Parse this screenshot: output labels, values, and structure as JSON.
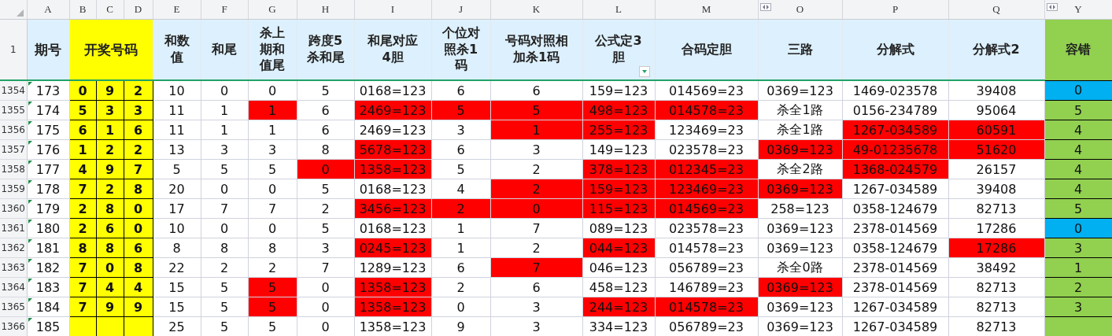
{
  "column_letters": [
    "A",
    "B",
    "C",
    "D",
    "E",
    "F",
    "G",
    "H",
    "I",
    "J",
    "K",
    "L",
    "M",
    "O",
    "P",
    "Q",
    "Y"
  ],
  "header": {
    "row_number": "1",
    "issue": "期号",
    "draw": "开奖号码",
    "columns": [
      "和数值",
      "和尾",
      "杀上期和值尾",
      "跨度5杀和尾",
      "和尾对应4胆",
      "个位对照杀1码",
      "号码对照相加杀1码",
      "公式定3胆",
      "合码定胆",
      "三路",
      "分解式",
      "分解式2"
    ],
    "tolerance": "容错"
  },
  "rows": [
    {
      "row_number": "1354",
      "issue": "173",
      "draw": [
        "0",
        "9",
        "2"
      ],
      "cells": [
        {
          "text": "10",
          "highlight": false
        },
        {
          "text": "0",
          "highlight": false
        },
        {
          "text": "0",
          "highlight": false
        },
        {
          "text": "5",
          "highlight": false
        },
        {
          "text": "0168=123",
          "highlight": false
        },
        {
          "text": "6",
          "highlight": false
        },
        {
          "text": "6",
          "highlight": false
        },
        {
          "text": "159=123",
          "highlight": false
        },
        {
          "text": "014569=23",
          "highlight": false
        },
        {
          "text": "0369=123",
          "highlight": false
        },
        {
          "text": "1469-023578",
          "highlight": false
        },
        {
          "text": "39408",
          "highlight": false
        }
      ],
      "tolerance": {
        "text": "0",
        "color": "#00b0f0"
      }
    },
    {
      "row_number": "1355",
      "issue": "174",
      "draw": [
        "5",
        "3",
        "3"
      ],
      "cells": [
        {
          "text": "11",
          "highlight": false
        },
        {
          "text": "1",
          "highlight": false
        },
        {
          "text": "1",
          "highlight": true
        },
        {
          "text": "6",
          "highlight": false
        },
        {
          "text": "2469=123",
          "highlight": true
        },
        {
          "text": "5",
          "highlight": true
        },
        {
          "text": "5",
          "highlight": true
        },
        {
          "text": "498=123",
          "highlight": true
        },
        {
          "text": "014578=23",
          "highlight": true
        },
        {
          "text": "杀全1路",
          "highlight": false
        },
        {
          "text": "0156-234789",
          "highlight": false
        },
        {
          "text": "95064",
          "highlight": false
        }
      ],
      "tolerance": {
        "text": "5",
        "color": "#92d050"
      }
    },
    {
      "row_number": "1356",
      "issue": "175",
      "draw": [
        "6",
        "1",
        "6"
      ],
      "cells": [
        {
          "text": "11",
          "highlight": false
        },
        {
          "text": "1",
          "highlight": false
        },
        {
          "text": "1",
          "highlight": false
        },
        {
          "text": "6",
          "highlight": false
        },
        {
          "text": "2469=123",
          "highlight": false
        },
        {
          "text": "3",
          "highlight": false
        },
        {
          "text": "1",
          "highlight": true
        },
        {
          "text": "255=123",
          "highlight": true
        },
        {
          "text": "123469=23",
          "highlight": false
        },
        {
          "text": "杀全1路",
          "highlight": false
        },
        {
          "text": "1267-034589",
          "highlight": true
        },
        {
          "text": "60591",
          "highlight": true
        }
      ],
      "tolerance": {
        "text": "4",
        "color": "#92d050"
      }
    },
    {
      "row_number": "1357",
      "issue": "176",
      "draw": [
        "1",
        "2",
        "2"
      ],
      "cells": [
        {
          "text": "13",
          "highlight": false
        },
        {
          "text": "3",
          "highlight": false
        },
        {
          "text": "3",
          "highlight": false
        },
        {
          "text": "8",
          "highlight": false
        },
        {
          "text": "5678=123",
          "highlight": true
        },
        {
          "text": "6",
          "highlight": false
        },
        {
          "text": "3",
          "highlight": false
        },
        {
          "text": "149=123",
          "highlight": false
        },
        {
          "text": "023578=23",
          "highlight": false
        },
        {
          "text": "0369=123",
          "highlight": true
        },
        {
          "text": "49-01235678",
          "highlight": true
        },
        {
          "text": "51620",
          "highlight": true
        }
      ],
      "tolerance": {
        "text": "4",
        "color": "#92d050"
      }
    },
    {
      "row_number": "1358",
      "issue": "177",
      "draw": [
        "4",
        "9",
        "7"
      ],
      "cells": [
        {
          "text": "5",
          "highlight": false
        },
        {
          "text": "5",
          "highlight": false
        },
        {
          "text": "5",
          "highlight": false
        },
        {
          "text": "0",
          "highlight": true
        },
        {
          "text": "1358=123",
          "highlight": true
        },
        {
          "text": "5",
          "highlight": false
        },
        {
          "text": "2",
          "highlight": false
        },
        {
          "text": "378=123",
          "highlight": true
        },
        {
          "text": "012345=23",
          "highlight": true
        },
        {
          "text": "杀全2路",
          "highlight": false
        },
        {
          "text": "1368-024579",
          "highlight": true
        },
        {
          "text": "26157",
          "highlight": false
        }
      ],
      "tolerance": {
        "text": "4",
        "color": "#92d050"
      }
    },
    {
      "row_number": "1359",
      "issue": "178",
      "draw": [
        "7",
        "2",
        "8"
      ],
      "cells": [
        {
          "text": "20",
          "highlight": false
        },
        {
          "text": "0",
          "highlight": false
        },
        {
          "text": "0",
          "highlight": false
        },
        {
          "text": "5",
          "highlight": false
        },
        {
          "text": "0168=123",
          "highlight": false
        },
        {
          "text": "4",
          "highlight": false
        },
        {
          "text": "2",
          "highlight": true
        },
        {
          "text": "159=123",
          "highlight": true
        },
        {
          "text": "123469=23",
          "highlight": true
        },
        {
          "text": "0369=123",
          "highlight": true
        },
        {
          "text": "1267-034589",
          "highlight": false
        },
        {
          "text": "39408",
          "highlight": false
        }
      ],
      "tolerance": {
        "text": "4",
        "color": "#92d050"
      }
    },
    {
      "row_number": "1360",
      "issue": "179",
      "draw": [
        "2",
        "8",
        "0"
      ],
      "cells": [
        {
          "text": "17",
          "highlight": false
        },
        {
          "text": "7",
          "highlight": false
        },
        {
          "text": "7",
          "highlight": false
        },
        {
          "text": "2",
          "highlight": false
        },
        {
          "text": "3456=123",
          "highlight": true
        },
        {
          "text": "2",
          "highlight": true
        },
        {
          "text": "0",
          "highlight": true
        },
        {
          "text": "115=123",
          "highlight": true
        },
        {
          "text": "014569=23",
          "highlight": true
        },
        {
          "text": "258=123",
          "highlight": false
        },
        {
          "text": "0358-124679",
          "highlight": false
        },
        {
          "text": "82713",
          "highlight": false
        }
      ],
      "tolerance": {
        "text": "5",
        "color": "#92d050"
      }
    },
    {
      "row_number": "1361",
      "issue": "180",
      "draw": [
        "2",
        "6",
        "0"
      ],
      "cells": [
        {
          "text": "10",
          "highlight": false
        },
        {
          "text": "0",
          "highlight": false
        },
        {
          "text": "0",
          "highlight": false
        },
        {
          "text": "5",
          "highlight": false
        },
        {
          "text": "0168=123",
          "highlight": false
        },
        {
          "text": "1",
          "highlight": false
        },
        {
          "text": "7",
          "highlight": false
        },
        {
          "text": "089=123",
          "highlight": false
        },
        {
          "text": "023578=23",
          "highlight": false
        },
        {
          "text": "0369=123",
          "highlight": false
        },
        {
          "text": "2378-014569",
          "highlight": false
        },
        {
          "text": "17286",
          "highlight": false
        }
      ],
      "tolerance": {
        "text": "0",
        "color": "#00b0f0"
      }
    },
    {
      "row_number": "1362",
      "issue": "181",
      "draw": [
        "8",
        "8",
        "6"
      ],
      "cells": [
        {
          "text": "8",
          "highlight": false
        },
        {
          "text": "8",
          "highlight": false
        },
        {
          "text": "8",
          "highlight": false
        },
        {
          "text": "3",
          "highlight": false
        },
        {
          "text": "0245=123",
          "highlight": true
        },
        {
          "text": "1",
          "highlight": false
        },
        {
          "text": "2",
          "highlight": false
        },
        {
          "text": "044=123",
          "highlight": true
        },
        {
          "text": "014578=23",
          "highlight": false
        },
        {
          "text": "0369=123",
          "highlight": false
        },
        {
          "text": "0358-124679",
          "highlight": false
        },
        {
          "text": "17286",
          "highlight": true
        }
      ],
      "tolerance": {
        "text": "3",
        "color": "#92d050"
      }
    },
    {
      "row_number": "1363",
      "issue": "182",
      "draw": [
        "7",
        "0",
        "8"
      ],
      "cells": [
        {
          "text": "22",
          "highlight": false
        },
        {
          "text": "2",
          "highlight": false
        },
        {
          "text": "2",
          "highlight": false
        },
        {
          "text": "7",
          "highlight": false
        },
        {
          "text": "1289=123",
          "highlight": false
        },
        {
          "text": "6",
          "highlight": false
        },
        {
          "text": "7",
          "highlight": true
        },
        {
          "text": "046=123",
          "highlight": false
        },
        {
          "text": "056789=23",
          "highlight": false
        },
        {
          "text": "杀全0路",
          "highlight": false
        },
        {
          "text": "2378-014569",
          "highlight": false
        },
        {
          "text": "38492",
          "highlight": false
        }
      ],
      "tolerance": {
        "text": "1",
        "color": "#92d050"
      }
    },
    {
      "row_number": "1364",
      "issue": "183",
      "draw": [
        "7",
        "4",
        "4"
      ],
      "cells": [
        {
          "text": "15",
          "highlight": false
        },
        {
          "text": "5",
          "highlight": false
        },
        {
          "text": "5",
          "highlight": true
        },
        {
          "text": "0",
          "highlight": false
        },
        {
          "text": "1358=123",
          "highlight": true
        },
        {
          "text": "2",
          "highlight": false
        },
        {
          "text": "6",
          "highlight": false
        },
        {
          "text": "458=123",
          "highlight": false
        },
        {
          "text": "146789=23",
          "highlight": false
        },
        {
          "text": "0369=123",
          "highlight": true
        },
        {
          "text": "2378-014569",
          "highlight": false
        },
        {
          "text": "82713",
          "highlight": false
        }
      ],
      "tolerance": {
        "text": "2",
        "color": "#92d050"
      }
    },
    {
      "row_number": "1365",
      "issue": "184",
      "draw": [
        "7",
        "9",
        "9"
      ],
      "cells": [
        {
          "text": "15",
          "highlight": false
        },
        {
          "text": "5",
          "highlight": false
        },
        {
          "text": "5",
          "highlight": true
        },
        {
          "text": "0",
          "highlight": false
        },
        {
          "text": "1358=123",
          "highlight": true
        },
        {
          "text": "0",
          "highlight": false
        },
        {
          "text": "3",
          "highlight": false
        },
        {
          "text": "244=123",
          "highlight": true
        },
        {
          "text": "014578=23",
          "highlight": true
        },
        {
          "text": "0369=123",
          "highlight": false
        },
        {
          "text": "1267-034589",
          "highlight": false
        },
        {
          "text": "82713",
          "highlight": false
        }
      ],
      "tolerance": {
        "text": "3",
        "color": "#92d050"
      }
    },
    {
      "row_number": "1366",
      "issue": "185",
      "draw": [],
      "cells": [
        {
          "text": "25",
          "highlight": false
        },
        {
          "text": "5",
          "highlight": false
        },
        {
          "text": "5",
          "highlight": false
        },
        {
          "text": "0",
          "highlight": false
        },
        {
          "text": "1358=123",
          "highlight": false
        },
        {
          "text": "9",
          "highlight": false
        },
        {
          "text": "3",
          "highlight": false
        },
        {
          "text": "334=123",
          "highlight": false
        },
        {
          "text": "056789=23",
          "highlight": false
        },
        {
          "text": "0369=123",
          "highlight": false
        },
        {
          "text": "1267-034589",
          "highlight": false
        },
        {
          "text": "82713",
          "highlight": false
        }
      ],
      "tolerance": {
        "color": "#92d050"
      }
    }
  ]
}
